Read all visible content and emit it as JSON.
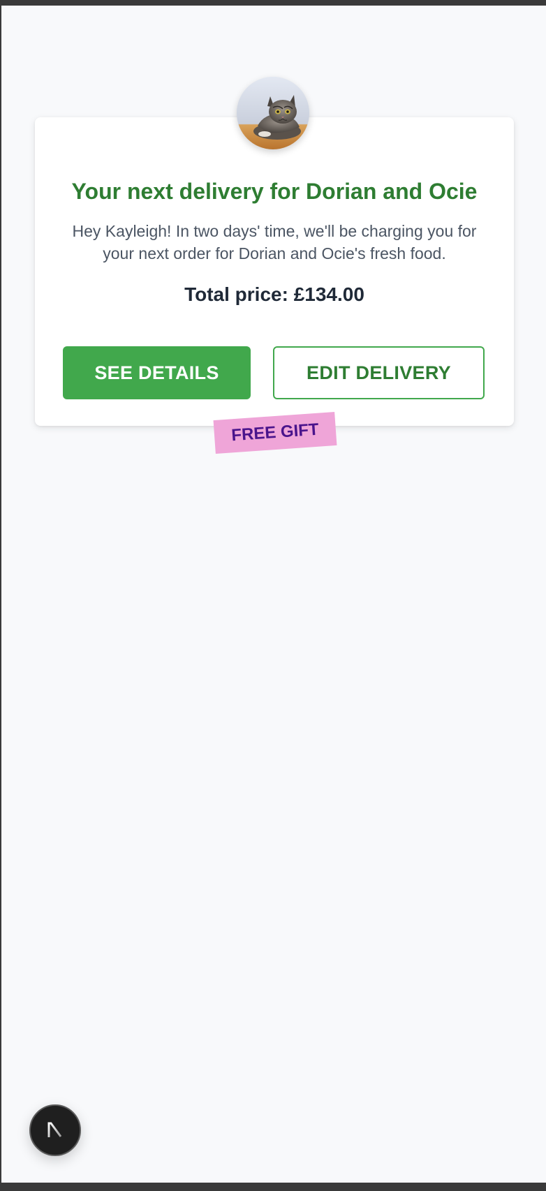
{
  "card": {
    "avatar_alt": "cat",
    "title": "Your next delivery for Dorian and Ocie",
    "message": "Hey Kayleigh! In two days' time, we'll be charging you for your next order for Dorian and Ocie's fresh food.",
    "total_price": "Total price: £134.00",
    "see_details_label": "SEE DETAILS",
    "edit_delivery_label": "EDIT DELIVERY",
    "free_gift_label": "FREE GIFT"
  },
  "nextjs_badge": {
    "icon": "nextjs-logo-icon",
    "letter": "N"
  },
  "colors": {
    "title_green": "#2e7d32",
    "button_green": "#41a84c",
    "gift_pink": "#efa5d8",
    "gift_text": "#4a148c",
    "page_background": "#f8f9fb"
  }
}
